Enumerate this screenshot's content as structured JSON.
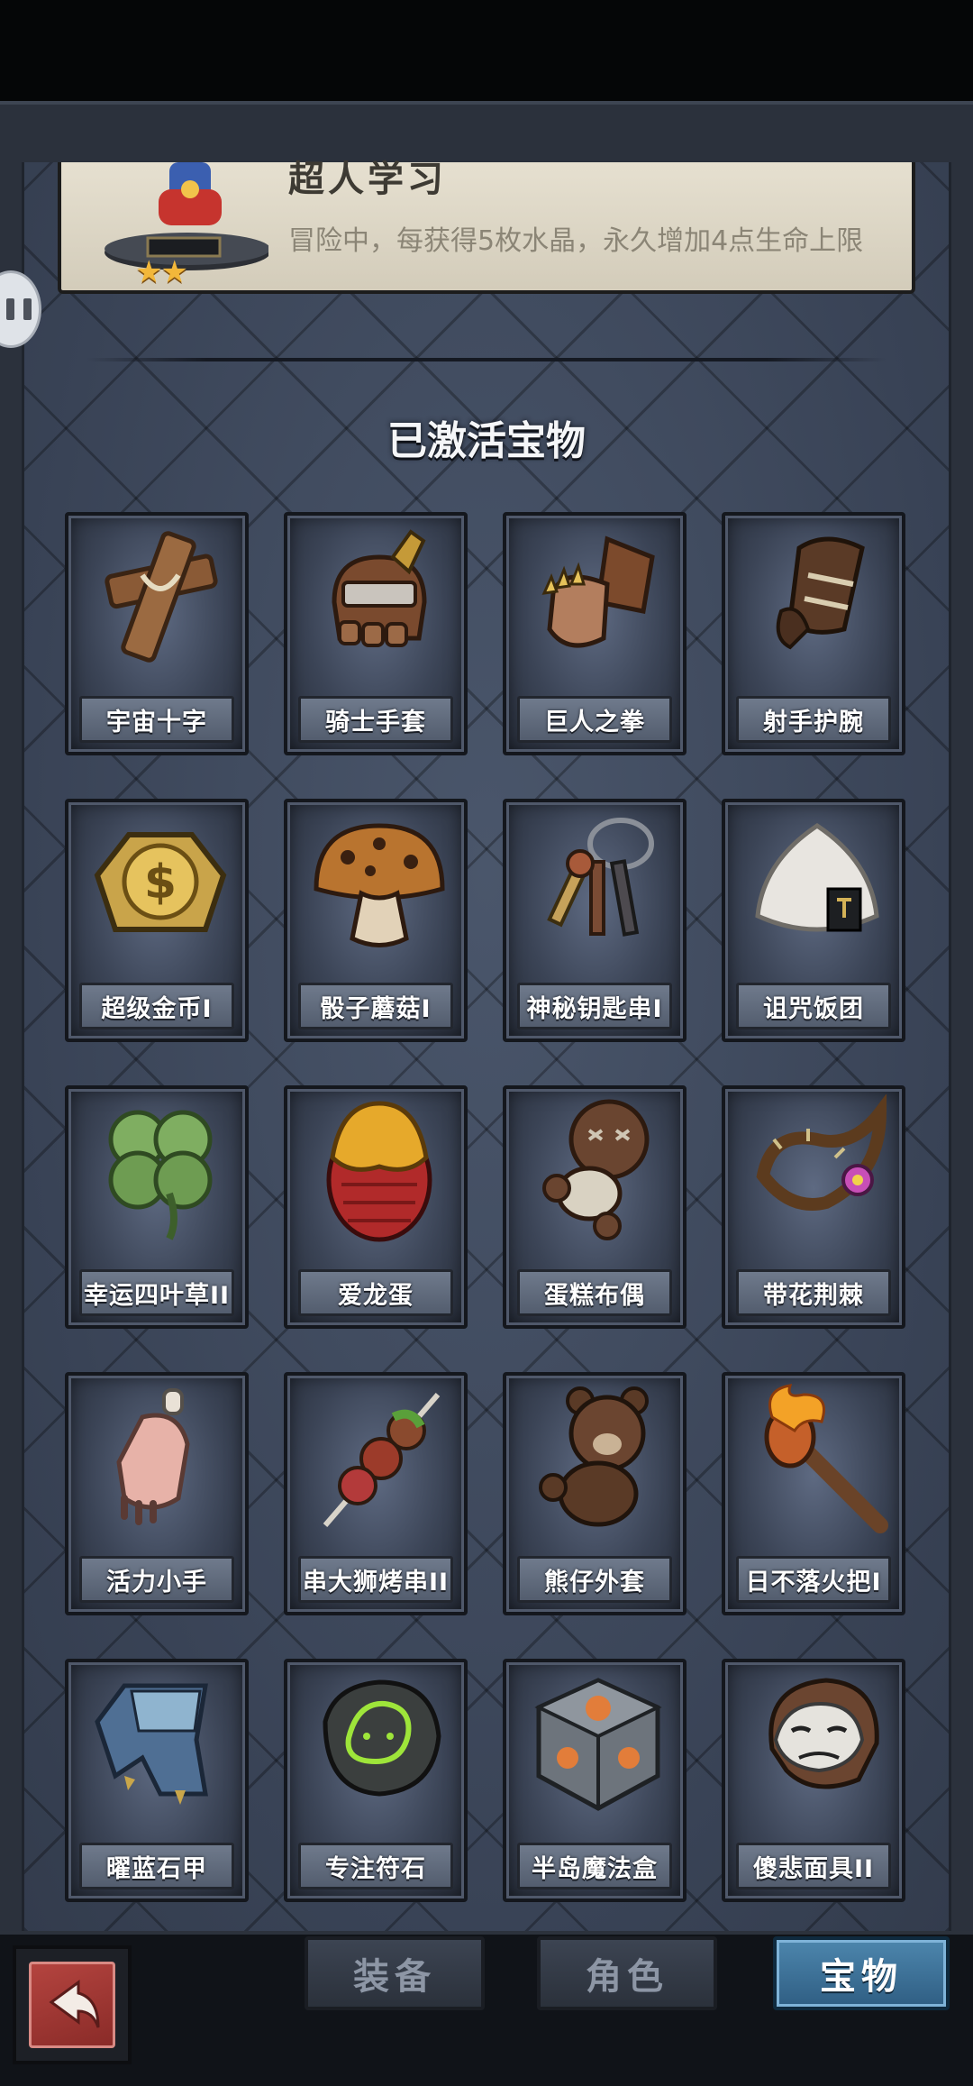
{
  "hero": {
    "title": "超人学习",
    "description": "冒险中，每获得5枚水晶，永久增加4点生命上限",
    "stars": "★★"
  },
  "section_title": "已激活宝物",
  "treasures": [
    {
      "label": "宇宙十字",
      "icon": "wooden-cross-icon"
    },
    {
      "label": "骑士手套",
      "icon": "knight-gauntlet-icon"
    },
    {
      "label": "巨人之拳",
      "icon": "giant-fist-icon"
    },
    {
      "label": "射手护腕",
      "icon": "archer-bracer-icon"
    },
    {
      "label": "超级金币I",
      "icon": "gold-coin-icon"
    },
    {
      "label": "骰子蘑菇I",
      "icon": "dice-mushroom-icon"
    },
    {
      "label": "神秘钥匙串I",
      "icon": "key-ring-icon"
    },
    {
      "label": "诅咒饭团",
      "icon": "rice-ball-icon"
    },
    {
      "label": "幸运四叶草II",
      "icon": "four-leaf-clover-icon"
    },
    {
      "label": "爱龙蛋",
      "icon": "dragon-egg-icon"
    },
    {
      "label": "蛋糕布偶",
      "icon": "voodoo-doll-icon"
    },
    {
      "label": "带花荆棘",
      "icon": "thorn-flower-icon"
    },
    {
      "label": "活力小手",
      "icon": "small-hand-icon"
    },
    {
      "label": "串大狮烤串II",
      "icon": "skewer-icon"
    },
    {
      "label": "熊仔外套",
      "icon": "teddy-bear-icon"
    },
    {
      "label": "日不落火把I",
      "icon": "torch-icon"
    },
    {
      "label": "曜蓝石甲",
      "icon": "blue-armor-icon"
    },
    {
      "label": "专注符石",
      "icon": "rune-stone-icon"
    },
    {
      "label": "半岛魔法盒",
      "icon": "magic-cube-icon"
    },
    {
      "label": "傻悲面具II",
      "icon": "mask-icon"
    }
  ],
  "tabs": {
    "equipment": "装备",
    "character": "角色",
    "treasure": "宝物"
  },
  "colors": {
    "panel": "#3c475a",
    "active_tab": "#3f79a0",
    "back_button": "#a33b37",
    "star": "#f2b73a"
  }
}
